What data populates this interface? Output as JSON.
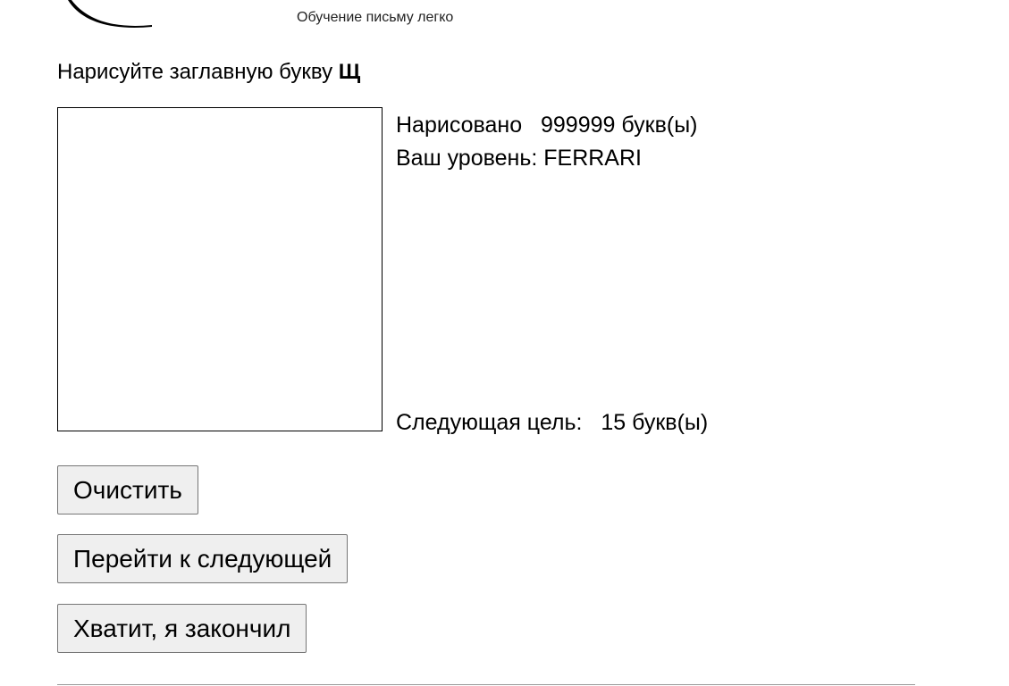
{
  "header": {
    "logo_icon": "crescent-logo-icon",
    "tagline": "Обучение письму легко"
  },
  "task": {
    "prompt_text": "Нарисуйте заглавную букву ",
    "letter": "Щ"
  },
  "stats": {
    "drawn_label": "Нарисовано",
    "drawn_count": "999999",
    "drawn_unit": "букв(ы)",
    "level_label": "Ваш уровень:",
    "level_value": "FERRARI",
    "next_goal_label": "Следующая цель:",
    "next_goal_count": "15",
    "next_goal_unit": "букв(ы)"
  },
  "buttons": {
    "clear": "Очистить",
    "next": "Перейти к следующей",
    "done": "Хватит, я закончил"
  }
}
